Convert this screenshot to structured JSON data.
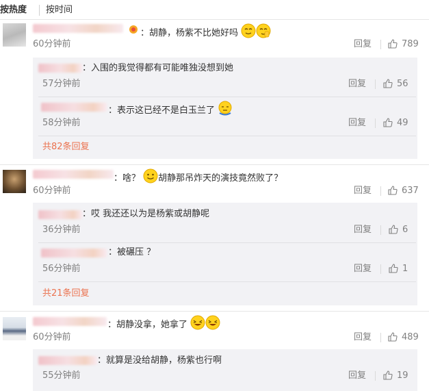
{
  "tabs": {
    "active": "按热度",
    "other": "按时间"
  },
  "labels": {
    "reply": "回复"
  },
  "colors": {
    "accent": "#eb7350",
    "muted": "#808080",
    "reply_bg": "#f2f2f5"
  },
  "comments": [
    {
      "text_prefix": "：胡静，杨紫不比她好吗",
      "time": "60分钟前",
      "likes": "789",
      "replies": [
        {
          "text": "：入围的我觉得都有可能唯独没想到她",
          "time": "57分钟前",
          "likes": "56"
        },
        {
          "text": "：表示这已经不是白玉兰了",
          "time": "58分钟前",
          "likes": "49"
        }
      ],
      "more": "共82条回复"
    },
    {
      "text_a": "：啥？",
      "text_b": "胡静那吊炸天的演技竟然败了？",
      "time": "60分钟前",
      "likes": "637",
      "replies": [
        {
          "text": "：哎 我还还以为是杨紫或胡静呢",
          "time": "36分钟前",
          "likes": "6"
        },
        {
          "text": "：被碾压 ？",
          "time": "56分钟前",
          "likes": "1"
        }
      ],
      "more": "共21条回复"
    },
    {
      "text": "：胡静没拿，她拿了",
      "time": "60分钟前",
      "likes": "489",
      "replies": [
        {
          "text": "：就算是没给胡静，杨紫也行啊",
          "time": "55分钟前",
          "likes": "19"
        }
      ]
    }
  ]
}
